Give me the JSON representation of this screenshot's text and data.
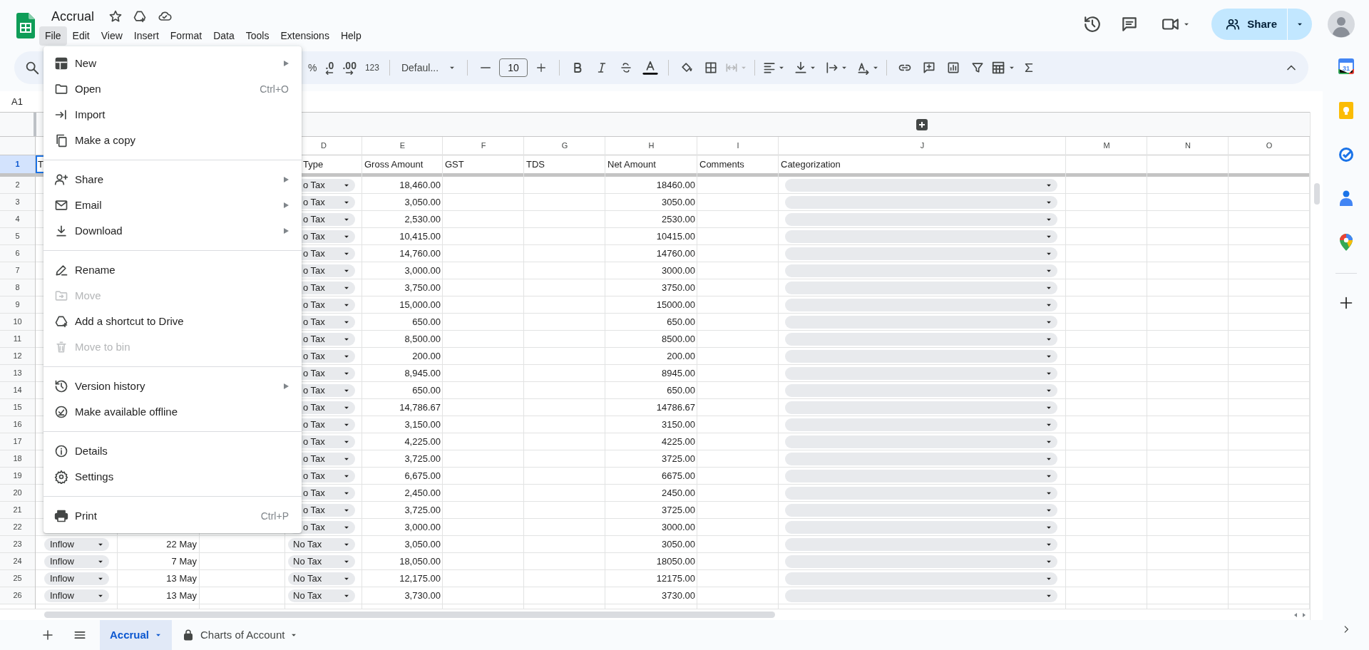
{
  "document": {
    "title": "Accrual"
  },
  "menu_bar": [
    {
      "label": "File",
      "selected": true
    },
    {
      "label": "Edit",
      "selected": false
    },
    {
      "label": "View",
      "selected": false
    },
    {
      "label": "Insert",
      "selected": false
    },
    {
      "label": "Format",
      "selected": false
    },
    {
      "label": "Data",
      "selected": false
    },
    {
      "label": "Tools",
      "selected": false
    },
    {
      "label": "Extensions",
      "selected": false
    },
    {
      "label": "Help",
      "selected": false
    }
  ],
  "toolbar": {
    "percent": "%",
    "decrease_decimal": ".0",
    "increase_decimal": ".00",
    "number_format": "123",
    "font": "Defaul...",
    "font_size": "10"
  },
  "share_button": "Share",
  "name_box": "A1",
  "side_panel": {
    "calendar_day": "31"
  },
  "column_headers": [
    "D",
    "E",
    "F",
    "G",
    "H",
    "I",
    "J",
    "M",
    "N",
    "O"
  ],
  "header_row": {
    "number": "1",
    "selected": true,
    "cells": [
      {
        "text": "T",
        "selected": true
      },
      {
        "text": "Type",
        "selected": false
      },
      {
        "text": "Gross Amount",
        "selected": false
      },
      {
        "text": "GST",
        "selected": false
      },
      {
        "text": "TDS",
        "selected": false
      },
      {
        "text": "Net Amount",
        "selected": false
      },
      {
        "text": "Comments",
        "selected": false
      },
      {
        "text": "Categorization",
        "selected": false
      }
    ]
  },
  "rows": [
    {
      "number": "2",
      "selected": false,
      "tax_type": "o Tax",
      "gross_amount": "18,460.00",
      "net_amount": "18460.00"
    },
    {
      "number": "3",
      "selected": false,
      "tax_type": "o Tax",
      "gross_amount": "3,050.00",
      "net_amount": "3050.00"
    },
    {
      "number": "4",
      "selected": false,
      "tax_type": "o Tax",
      "gross_amount": "2,530.00",
      "net_amount": "2530.00"
    },
    {
      "number": "5",
      "selected": false,
      "tax_type": "o Tax",
      "gross_amount": "10,415.00",
      "net_amount": "10415.00"
    },
    {
      "number": "6",
      "selected": false,
      "tax_type": "o Tax",
      "gross_amount": "14,760.00",
      "net_amount": "14760.00"
    },
    {
      "number": "7",
      "selected": false,
      "tax_type": "o Tax",
      "gross_amount": "3,000.00",
      "net_amount": "3000.00"
    },
    {
      "number": "8",
      "selected": false,
      "tax_type": "o Tax",
      "gross_amount": "3,750.00",
      "net_amount": "3750.00"
    },
    {
      "number": "9",
      "selected": false,
      "tax_type": "o Tax",
      "gross_amount": "15,000.00",
      "net_amount": "15000.00"
    },
    {
      "number": "10",
      "selected": false,
      "tax_type": "o Tax",
      "gross_amount": "650.00",
      "net_amount": "650.00"
    },
    {
      "number": "11",
      "selected": false,
      "tax_type": "o Tax",
      "gross_amount": "8,500.00",
      "net_amount": "8500.00"
    },
    {
      "number": "12",
      "selected": false,
      "tax_type": "o Tax",
      "gross_amount": "200.00",
      "net_amount": "200.00"
    },
    {
      "number": "13",
      "selected": false,
      "tax_type": "o Tax",
      "gross_amount": "8,945.00",
      "net_amount": "8945.00"
    },
    {
      "number": "14",
      "selected": false,
      "tax_type": "o Tax",
      "gross_amount": "650.00",
      "net_amount": "650.00"
    },
    {
      "number": "15",
      "selected": false,
      "tax_type": "o Tax",
      "gross_amount": "14,786.67",
      "net_amount": "14786.67"
    },
    {
      "number": "16",
      "selected": false,
      "tax_type": "o Tax",
      "gross_amount": "3,150.00",
      "net_amount": "3150.00"
    },
    {
      "number": "17",
      "selected": false,
      "tax_type": "o Tax",
      "gross_amount": "4,225.00",
      "net_amount": "4225.00"
    },
    {
      "number": "18",
      "selected": false,
      "tax_type": "o Tax",
      "gross_amount": "3,725.00",
      "net_amount": "3725.00"
    },
    {
      "number": "19",
      "selected": false,
      "tax_type": "o Tax",
      "gross_amount": "6,675.00",
      "net_amount": "6675.00"
    },
    {
      "number": "20",
      "selected": false,
      "tax_type": "o Tax",
      "gross_amount": "2,450.00",
      "net_amount": "2450.00"
    },
    {
      "number": "21",
      "selected": false,
      "tax_type": "o Tax",
      "gross_amount": "3,725.00",
      "net_amount": "3725.00"
    },
    {
      "number": "22",
      "selected": false,
      "tax_type": "o Tax",
      "gross_amount": "3,000.00",
      "net_amount": "3000.00"
    },
    {
      "number": "23",
      "selected": false,
      "flow": "Inflow",
      "date": "22 May",
      "tax_type": "No Tax",
      "gross_amount": "3,050.00",
      "net_amount": "3050.00"
    },
    {
      "number": "24",
      "selected": false,
      "flow": "Inflow",
      "date": "7 May",
      "tax_type": "No Tax",
      "gross_amount": "18,050.00",
      "net_amount": "18050.00"
    },
    {
      "number": "25",
      "selected": false,
      "flow": "Inflow",
      "date": "13 May",
      "tax_type": "No Tax",
      "gross_amount": "12,175.00",
      "net_amount": "12175.00"
    },
    {
      "number": "26",
      "selected": false,
      "flow": "Inflow",
      "date": "13 May",
      "tax_type": "No Tax",
      "gross_amount": "3,730.00",
      "net_amount": "3730.00"
    }
  ],
  "file_menu": [
    [
      {
        "label": "New",
        "submenu": true,
        "disabled": false
      },
      {
        "label": "Open",
        "shortcut": "Ctrl+O",
        "submenu": false,
        "disabled": false
      },
      {
        "label": "Import",
        "submenu": false,
        "disabled": false
      },
      {
        "label": "Make a copy",
        "submenu": false,
        "disabled": false
      }
    ],
    [
      {
        "label": "Share",
        "submenu": true,
        "disabled": false
      },
      {
        "label": "Email",
        "submenu": true,
        "disabled": false
      },
      {
        "label": "Download",
        "submenu": true,
        "disabled": false
      }
    ],
    [
      {
        "label": "Rename",
        "submenu": false,
        "disabled": false
      },
      {
        "label": "Move",
        "submenu": false,
        "disabled": true
      },
      {
        "label": "Add a shortcut to Drive",
        "submenu": false,
        "disabled": false
      },
      {
        "label": "Move to bin",
        "submenu": false,
        "disabled": true
      }
    ],
    [
      {
        "label": "Version history",
        "submenu": true,
        "disabled": false
      },
      {
        "label": "Make available offline",
        "submenu": false,
        "disabled": false
      }
    ],
    [
      {
        "label": "Details",
        "submenu": false,
        "disabled": false
      },
      {
        "label": "Settings",
        "submenu": false,
        "disabled": false
      }
    ],
    [
      {
        "label": "Print",
        "shortcut": "Ctrl+P",
        "submenu": false,
        "disabled": false
      }
    ]
  ],
  "sheet_tabs": [
    {
      "label": "Accrual",
      "selected": true,
      "locked": false
    },
    {
      "label": "Charts of Account",
      "selected": false,
      "locked": true
    }
  ]
}
